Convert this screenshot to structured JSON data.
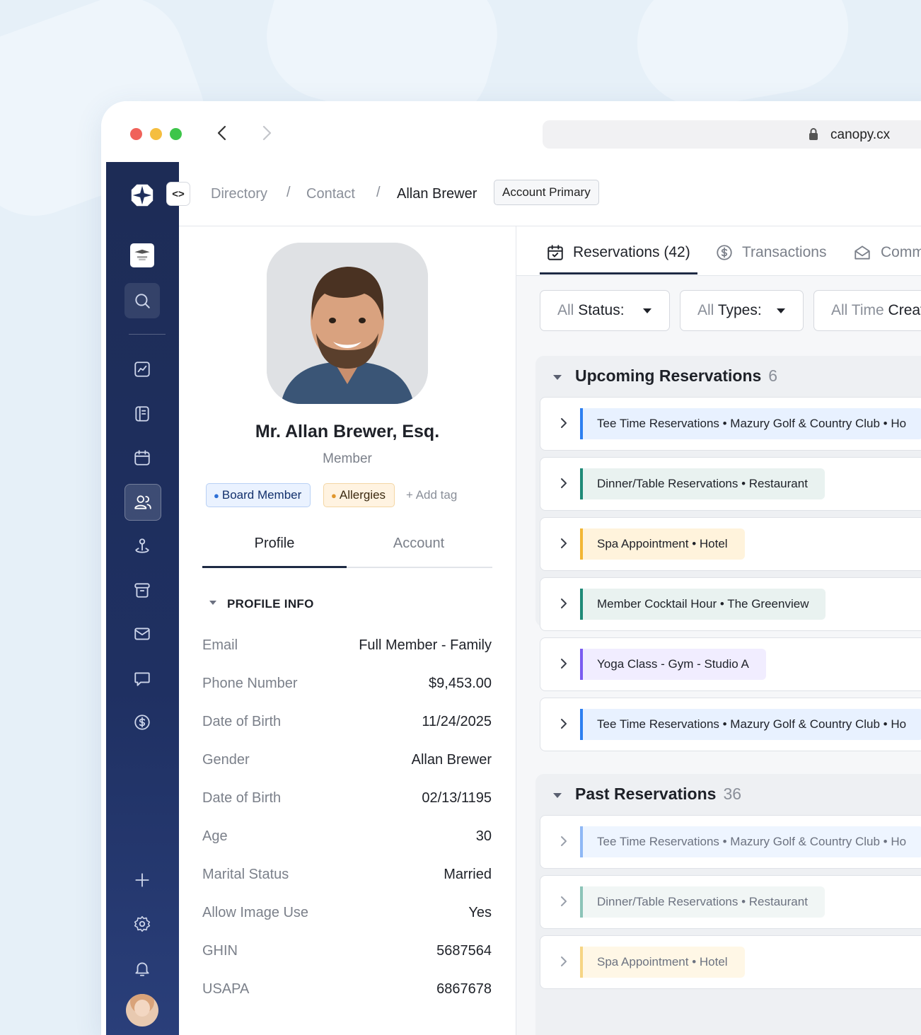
{
  "browser": {
    "url": "canopy.cx"
  },
  "breadcrumb": {
    "items": [
      "Directory",
      "Contact"
    ],
    "current": "Allan Brewer",
    "badge": "Account Primary"
  },
  "profile": {
    "name": "Mr. Allan Brewer, Esq.",
    "role": "Member",
    "tags": [
      {
        "label": "Board Member",
        "color": "#2d6fd6"
      },
      {
        "label": "Allergies",
        "color": "#e0962c"
      }
    ],
    "add_tag": "+ Add tag",
    "tabs": [
      "Profile",
      "Account"
    ],
    "section_title": "PROFILE INFO",
    "rows": [
      {
        "label": "Email",
        "value": "Full Member - Family"
      },
      {
        "label": "Phone Number",
        "value": "$9,453.00"
      },
      {
        "label": "Date of Birth",
        "value": "11/24/2025"
      },
      {
        "label": "Gender",
        "value": "Allan Brewer"
      },
      {
        "label": "Date of Birth",
        "value": "02/13/1195"
      },
      {
        "label": "Age",
        "value": "30"
      },
      {
        "label": "Marital Status",
        "value": "Married"
      },
      {
        "label": "Allow Image Use",
        "value": "Yes"
      },
      {
        "label": "GHIN",
        "value": "5687564"
      },
      {
        "label": "USAPA",
        "value": "6867678"
      }
    ]
  },
  "right": {
    "tabs": [
      "Reservations (42)",
      "Transactions",
      "Communications"
    ],
    "filters": [
      {
        "muted": "All",
        "label": "Status:"
      },
      {
        "muted": "All",
        "label": "Types:"
      },
      {
        "muted": "All Time",
        "label": "Created"
      }
    ],
    "upcoming": {
      "title": "Upcoming Reservations",
      "count": "6",
      "items": [
        {
          "label": "Tee Time Reservations • Mazury Golf & Country Club • Ho",
          "color": "#2d7ff0",
          "bg": "#e8f1ff"
        },
        {
          "label": "Dinner/Table Reservations • Restaurant",
          "color": "#1f8a78",
          "bg": "#e9f2f0"
        },
        {
          "label": "Spa Appointment • Hotel",
          "color": "#f2b634",
          "bg": "#fff3dc"
        },
        {
          "label": "Member Cocktail Hour • The Greenview",
          "color": "#1f8a78",
          "bg": "#e9f2f0"
        },
        {
          "label": "Yoga Class - Gym - Studio A",
          "color": "#7b5cf0",
          "bg": "#f1edff"
        },
        {
          "label": "Tee Time Reservations • Mazury Golf & Country Club • Ho",
          "color": "#2d7ff0",
          "bg": "#e8f1ff"
        }
      ]
    },
    "past": {
      "title": "Past Reservations",
      "count": "36",
      "items": [
        {
          "label": "Tee Time Reservations • Mazury Golf & Country Club • Ho",
          "color": "#8fb8f5",
          "bg": "#eef5ff"
        },
        {
          "label": "Dinner/Table Reservations • Restaurant",
          "color": "#8cc4b8",
          "bg": "#f1f6f5"
        },
        {
          "label": "Spa Appointment • Hotel",
          "color": "#f6d584",
          "bg": "#fff7e6"
        }
      ]
    }
  }
}
